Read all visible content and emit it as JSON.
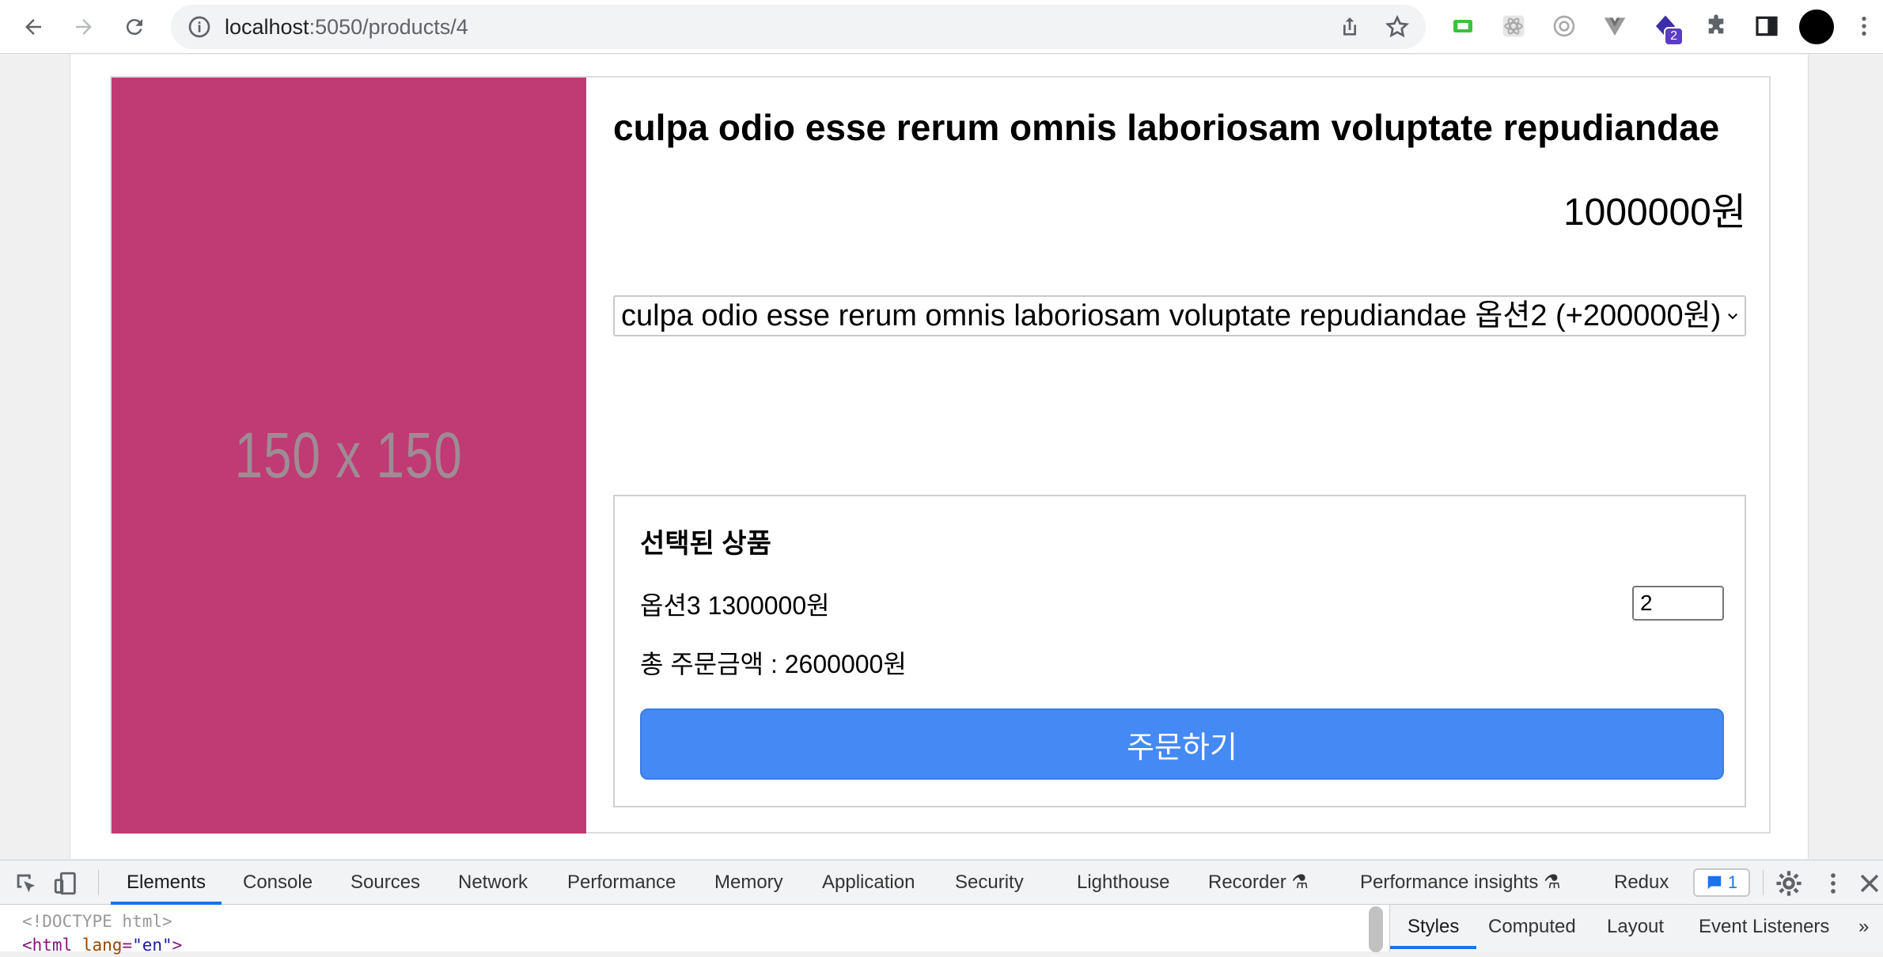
{
  "browser": {
    "url_host": "localhost",
    "url_path": ":5050/products/4",
    "extension_badge": "2"
  },
  "product": {
    "image_placeholder": "150 x 150",
    "image_color": "#c03a73",
    "title": "culpa odio esse rerum omnis laboriosam voluptate repudiandae",
    "price": "1000000원",
    "option_select_value": "culpa odio esse rerum omnis laboriosam voluptate repudiandae 옵션2 (+200000원)"
  },
  "selected": {
    "heading": "선택된 상품",
    "item_label": "옵션3 1300000원",
    "quantity": "2",
    "total_label": "총 주문금액 : 2600000원",
    "order_button": "주문하기",
    "button_color": "#4589f4"
  },
  "devtools": {
    "tabs": [
      "Elements",
      "Console",
      "Sources",
      "Network",
      "Performance",
      "Memory",
      "Application",
      "Security",
      "Lighthouse",
      "Recorder",
      "Performance insights",
      "Redux"
    ],
    "active_tab": "Elements",
    "message_count": "1",
    "code_line1": "<!DOCTYPE html>",
    "code_line2_tag_open": "<html ",
    "code_line2_attr": "lang",
    "code_line2_val": "\"en\"",
    "code_line2_tag_close": ">",
    "side_tabs": [
      "Styles",
      "Computed",
      "Layout",
      "Event Listeners"
    ],
    "side_active": "Styles"
  }
}
